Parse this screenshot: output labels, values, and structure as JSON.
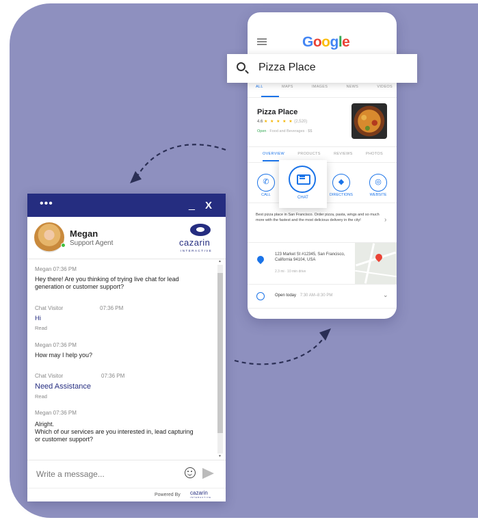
{
  "search": {
    "query": "Pizza Place"
  },
  "phone": {
    "brand_letters": [
      {
        "ch": "G",
        "color": "#4285f4"
      },
      {
        "ch": "o",
        "color": "#ea4335"
      },
      {
        "ch": "o",
        "color": "#fbbc05"
      },
      {
        "ch": "g",
        "color": "#4285f4"
      },
      {
        "ch": "l",
        "color": "#34a853"
      },
      {
        "ch": "e",
        "color": "#ea4335"
      }
    ],
    "tabs": [
      "ALL",
      "MAPS",
      "IMAGES",
      "NEWS",
      "VIDEOS"
    ],
    "place": {
      "name": "Pizza Place",
      "rating": "4.6",
      "stars": "★ ★ ★ ★ ★",
      "review_count": "(2,520)",
      "open": "Open",
      "type": "· Food and Beverages · $$"
    },
    "subtabs": [
      "OVERVIEW",
      "PRODUCTS",
      "REVIEWS",
      "PHOTOS"
    ],
    "actions": {
      "call": "CALL",
      "chat": "CHAT",
      "directions": "DIRECTIONS",
      "website": "WEBSITE"
    },
    "description": "Best pizza place in San Francisco. Order pizza, pasta, wings and so much more with the fastest and the most delicious delivery in the city!",
    "address": "123 Market St #12345, San Francisco, California 94104, USA",
    "distance": "2.3 mi · 10 min drive",
    "hours_status": "Open today",
    "hours_time": "7:30 AM–8:30 PM"
  },
  "chat": {
    "header": {
      "menu": "•••",
      "minimize": "_",
      "close": "X"
    },
    "agent": {
      "name": "Megan",
      "role": "Support Agent"
    },
    "brand": {
      "name": "cazarin",
      "tagline": "INTERACTIVE"
    },
    "messages": [
      {
        "meta": "Megan 07:36 PM",
        "text": "Hey there! Are you thinking of trying live chat for lead generation or customer support?"
      },
      {
        "sender": "Chat Visitor",
        "time": "07:36 PM",
        "text": "Hi",
        "status": "Read"
      },
      {
        "meta": "Megan 07:36 PM",
        "text": "How may I help you?"
      },
      {
        "sender": "Chat Visitor",
        "time": "07:36 PM",
        "text": "Need Assistance",
        "status": "Read"
      },
      {
        "meta": "Megan 07:36 PM",
        "text": "Alright.\nWhich of our services are you interested in, lead capturing or customer support?"
      }
    ],
    "input_placeholder": "Write a message...",
    "footer": {
      "powered_by": "Powered By",
      "logo": "cazarin",
      "logo_sub": "INTERACTIVE"
    }
  }
}
